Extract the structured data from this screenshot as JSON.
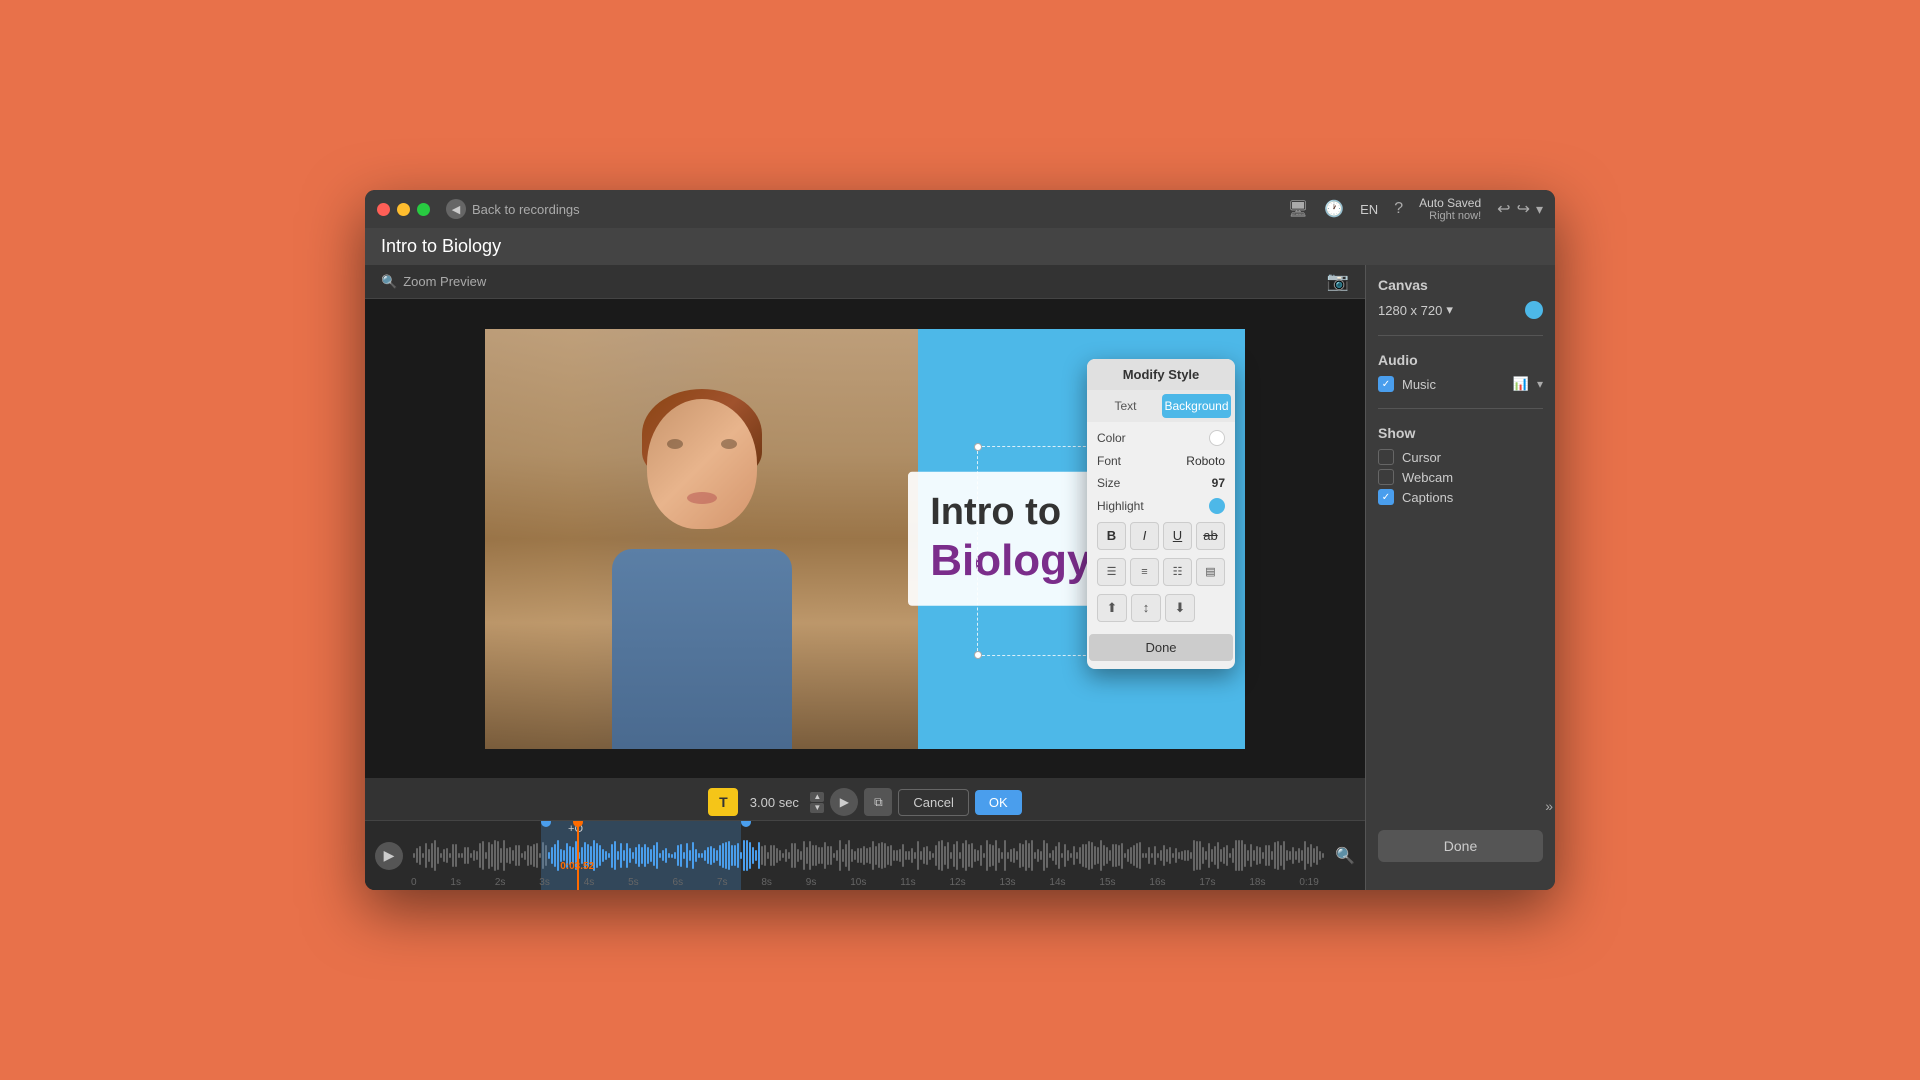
{
  "window": {
    "title": "Intro to Biology"
  },
  "titlebar": {
    "traffic_lights": [
      "red",
      "yellow",
      "green"
    ],
    "back_label": "Back to recordings",
    "autosave_label": "Auto Saved",
    "autosave_sub": "Right now!",
    "lang": "EN"
  },
  "header": {
    "project_title": "Intro to Biology"
  },
  "canvas": {
    "section_label": "Canvas",
    "size_label": "1280 x 720",
    "canvas_color": "#4db8e8"
  },
  "audio": {
    "section_label": "Audio",
    "music_label": "Music",
    "music_checked": true
  },
  "show": {
    "section_label": "Show",
    "cursor_label": "Cursor",
    "cursor_checked": false,
    "webcam_label": "Webcam",
    "webcam_checked": false,
    "captions_label": "Captions",
    "captions_checked": true
  },
  "done_btn": "Done",
  "zoom": {
    "label": "Zoom Preview"
  },
  "video": {
    "text_line1": "Intro to",
    "text_line2": "Biology"
  },
  "timeline": {
    "time_marker": "3.00 sec",
    "cancel_label": "Cancel",
    "ok_label": "OK",
    "play_btn": "▶",
    "current_time": "0:03.52",
    "ruler_labels": [
      "0",
      "1s",
      "2s",
      "3s",
      "4s",
      "5s",
      "6s",
      "7s",
      "8s",
      "9s",
      "10s",
      "11s",
      "12s",
      "13s",
      "14s",
      "15s",
      "16s",
      "17s",
      "18s",
      "0:19"
    ]
  },
  "modify_style": {
    "title": "Modify Style",
    "tab_text": "Text",
    "tab_background": "Background",
    "active_tab": "Background",
    "color_label": "Color",
    "font_label": "Font",
    "font_value": "Roboto",
    "size_label": "Size",
    "size_value": "97",
    "highlight_label": "Highlight",
    "bold_label": "B",
    "italic_label": "I",
    "underline_label": "U",
    "strikethrough_label": "ab",
    "done_label": "Done"
  }
}
